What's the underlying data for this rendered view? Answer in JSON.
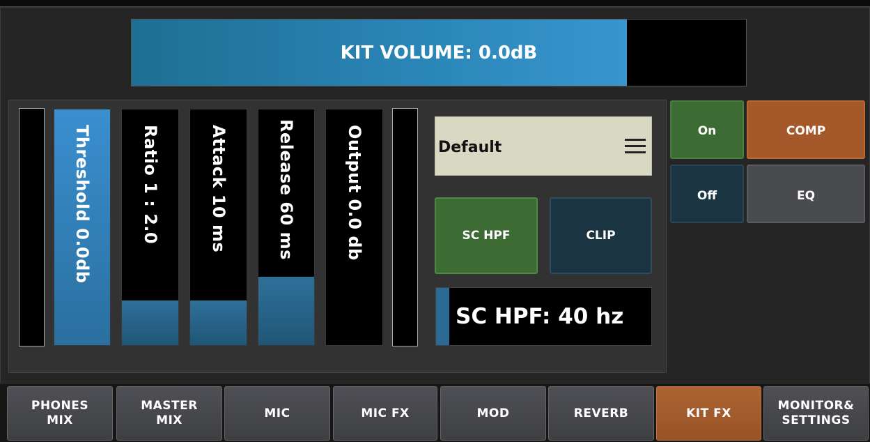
{
  "kit_volume": {
    "label": "KIT VOLUME: 0.0dB",
    "fill_fraction": 0.806
  },
  "compressor": {
    "faders": [
      {
        "label": "Threshold 0.0db",
        "fill_fraction": 1.0
      },
      {
        "label": "Ratio 1 : 2.0",
        "fill_fraction": 0.19
      },
      {
        "label": "Attack 10 ms",
        "fill_fraction": 0.19
      },
      {
        "label": "Release 60 ms",
        "fill_fraction": 0.29
      },
      {
        "label": "Output 0.0 db",
        "fill_fraction": 0.0
      }
    ],
    "input_meter_level": 0.0,
    "output_meter_level": 0.0
  },
  "preset": {
    "name": "Default",
    "icon": "hamburger-menu-icon"
  },
  "buttons": {
    "sc_hpf": "SC HPF",
    "clip": "CLIP",
    "on": "On",
    "off": "Off",
    "comp": "COMP",
    "eq": "EQ"
  },
  "sc_hpf_slider": {
    "label": "SC HPF: 40 hz",
    "fill_fraction": 0.06
  },
  "tabs": [
    {
      "label": "PHONES\nMIX"
    },
    {
      "label": "MASTER\nMIX"
    },
    {
      "label": "MIC"
    },
    {
      "label": "MIC FX"
    },
    {
      "label": "MOD"
    },
    {
      "label": "REVERB"
    },
    {
      "label": "KIT FX",
      "active": true
    },
    {
      "label": "MONITOR&\nSETTINGS"
    }
  ],
  "colors": {
    "accent_blue": "#2b86b8",
    "active_orange": "#a5592a",
    "on_green": "#3c6b33",
    "off_navy": "#1b3442"
  }
}
